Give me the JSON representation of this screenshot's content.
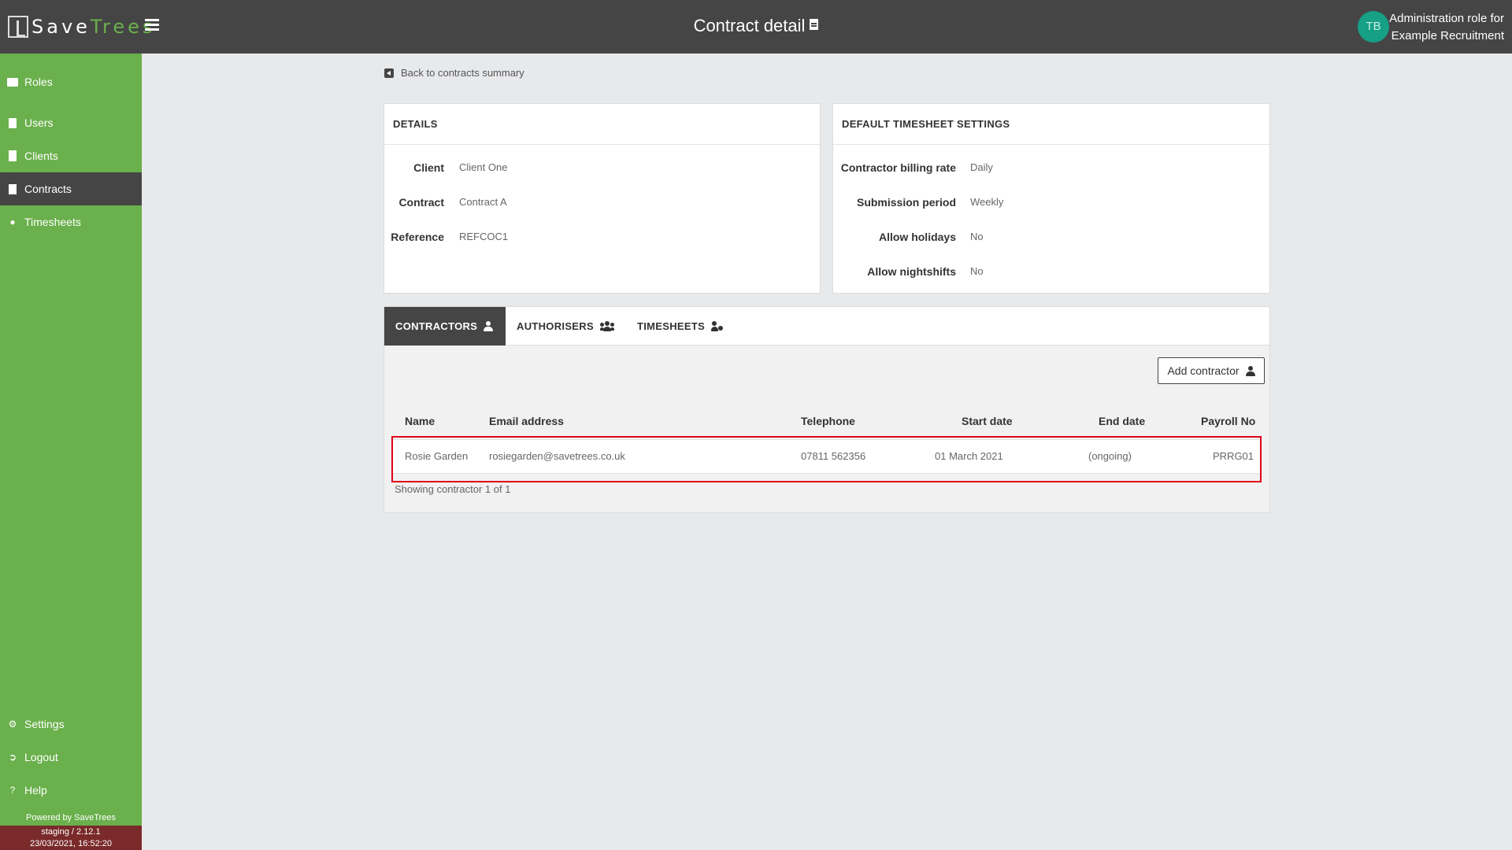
{
  "header": {
    "logo_save": "Save",
    "logo_trees": "Trees",
    "title": "Contract detail",
    "avatar_initials": "TB",
    "role_line1": "Administration role for",
    "role_line2": "Example Recruitment"
  },
  "sidebar": {
    "items": [
      {
        "label": "Roles",
        "icon": "id-card-icon"
      },
      {
        "label": "Users",
        "icon": "user-badge-icon"
      },
      {
        "label": "Clients",
        "icon": "building-icon"
      },
      {
        "label": "Contracts",
        "icon": "file-icon",
        "active": true
      },
      {
        "label": "Timesheets",
        "icon": "user-clock-icon"
      }
    ],
    "bottom_items": [
      {
        "label": "Settings",
        "icon": "gear-icon"
      },
      {
        "label": "Logout",
        "icon": "logout-icon"
      },
      {
        "label": "Help",
        "icon": "help-icon"
      }
    ],
    "powered_by": "Powered by SaveTrees",
    "env_line1": "staging / 2.12.1",
    "env_line2": "23/03/2021, 16:52:20"
  },
  "back_link": "Back to contracts summary",
  "details": {
    "heading": "DETAILS",
    "fields": [
      {
        "label": "Client",
        "value": "Client One"
      },
      {
        "label": "Contract",
        "value": "Contract A"
      },
      {
        "label": "Reference",
        "value": "REFCOC1"
      }
    ]
  },
  "timesheet_settings": {
    "heading": "DEFAULT TIMESHEET SETTINGS",
    "fields": [
      {
        "label": "Contractor billing rate",
        "value": "Daily"
      },
      {
        "label": "Submission period",
        "value": "Weekly"
      },
      {
        "label": "Allow holidays",
        "value": "No"
      },
      {
        "label": "Allow nightshifts",
        "value": "No"
      }
    ]
  },
  "tabs": [
    {
      "label": "CONTRACTORS",
      "active": true
    },
    {
      "label": "AUTHORISERS"
    },
    {
      "label": "TIMESHEETS"
    }
  ],
  "add_button": "Add contractor",
  "table": {
    "headers": [
      "Name",
      "Email address",
      "Telephone",
      "Start date",
      "End date",
      "Payroll No"
    ],
    "rows": [
      [
        "Rosie Garden",
        "rosiegarden@savetrees.co.uk",
        "07811 562356",
        "01 March 2021",
        "(ongoing)",
        "PRRG01"
      ]
    ],
    "showing": "Showing contractor 1 of 1"
  },
  "colors": {
    "sidebar": "#6ab04c",
    "topbar": "#454545",
    "highlight": "#e0001a"
  }
}
